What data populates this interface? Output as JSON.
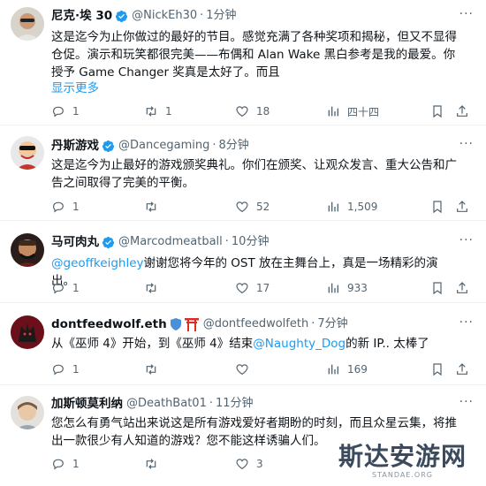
{
  "tweets": [
    {
      "name": "尼克·埃 30",
      "handle": "@NickEh30",
      "time": "1分钟",
      "text": "这是迄今为止你做过的最好的节目。感觉充满了各种奖项和揭秘，但又不显得仓促。演示和玩笑都很完美——布偶和 Alan Wake 黑白参考是我的最爱。你授予 Game Changer 奖真是太好了。而且",
      "show_more": "显示更多",
      "reply_count": "1",
      "retweet_count": "1",
      "like_count": "18",
      "views_count": "四十四"
    },
    {
      "name": "丹斯游戏",
      "handle": "@Dancegaming",
      "time": "8分钟",
      "text": "这是迄今为止最好的游戏颁奖典礼。你们在颁奖、让观众发言、重大公告和广告之间取得了完美的平衡。",
      "reply_count": "1",
      "retweet_count": "",
      "like_count": "52",
      "views_count": "1,509"
    },
    {
      "name": "马可肉丸",
      "handle": "@Marcodmeatball",
      "time": "10分钟",
      "mention": "@geoffkeighley",
      "text": "谢谢您将今年的 OST 放在主舞台上，真是一场精彩的演出。",
      "reply_count": "1",
      "retweet_count": "",
      "like_count": "17",
      "views_count": "933"
    },
    {
      "name": "dontfeedwolf.eth",
      "handle": "@dontfeedwolfeth",
      "time": "7分钟",
      "text_before": "从《巫师 4》开始，到《巫师 4》结束",
      "mention": "@Naughty_Dog",
      "text_after": "的新 IP.. 太棒了",
      "reply_count": "1",
      "retweet_count": "",
      "like_count": "",
      "views_count": "169"
    },
    {
      "name": "加斯顿莫利纳",
      "handle": "@DeathBat01",
      "time": "11分钟",
      "text": "您怎么有勇气站出来说这是所有游戏爱好者期盼的时刻，而且众星云集，将推出一款很少有人知道的游戏？您不能这样诱骗人们。",
      "reply_count": "1",
      "retweet_count": "",
      "like_count": "3",
      "views_count": ""
    }
  ],
  "more_icon": "···",
  "sep": "·",
  "watermark": {
    "main": "斯达安游网",
    "sub": "STANDAE.ORG"
  },
  "colors": {
    "accent": "#1d9bf0",
    "secondary_text": "#536471",
    "primary_text": "#0f1419",
    "divider": "#eff3f4"
  }
}
